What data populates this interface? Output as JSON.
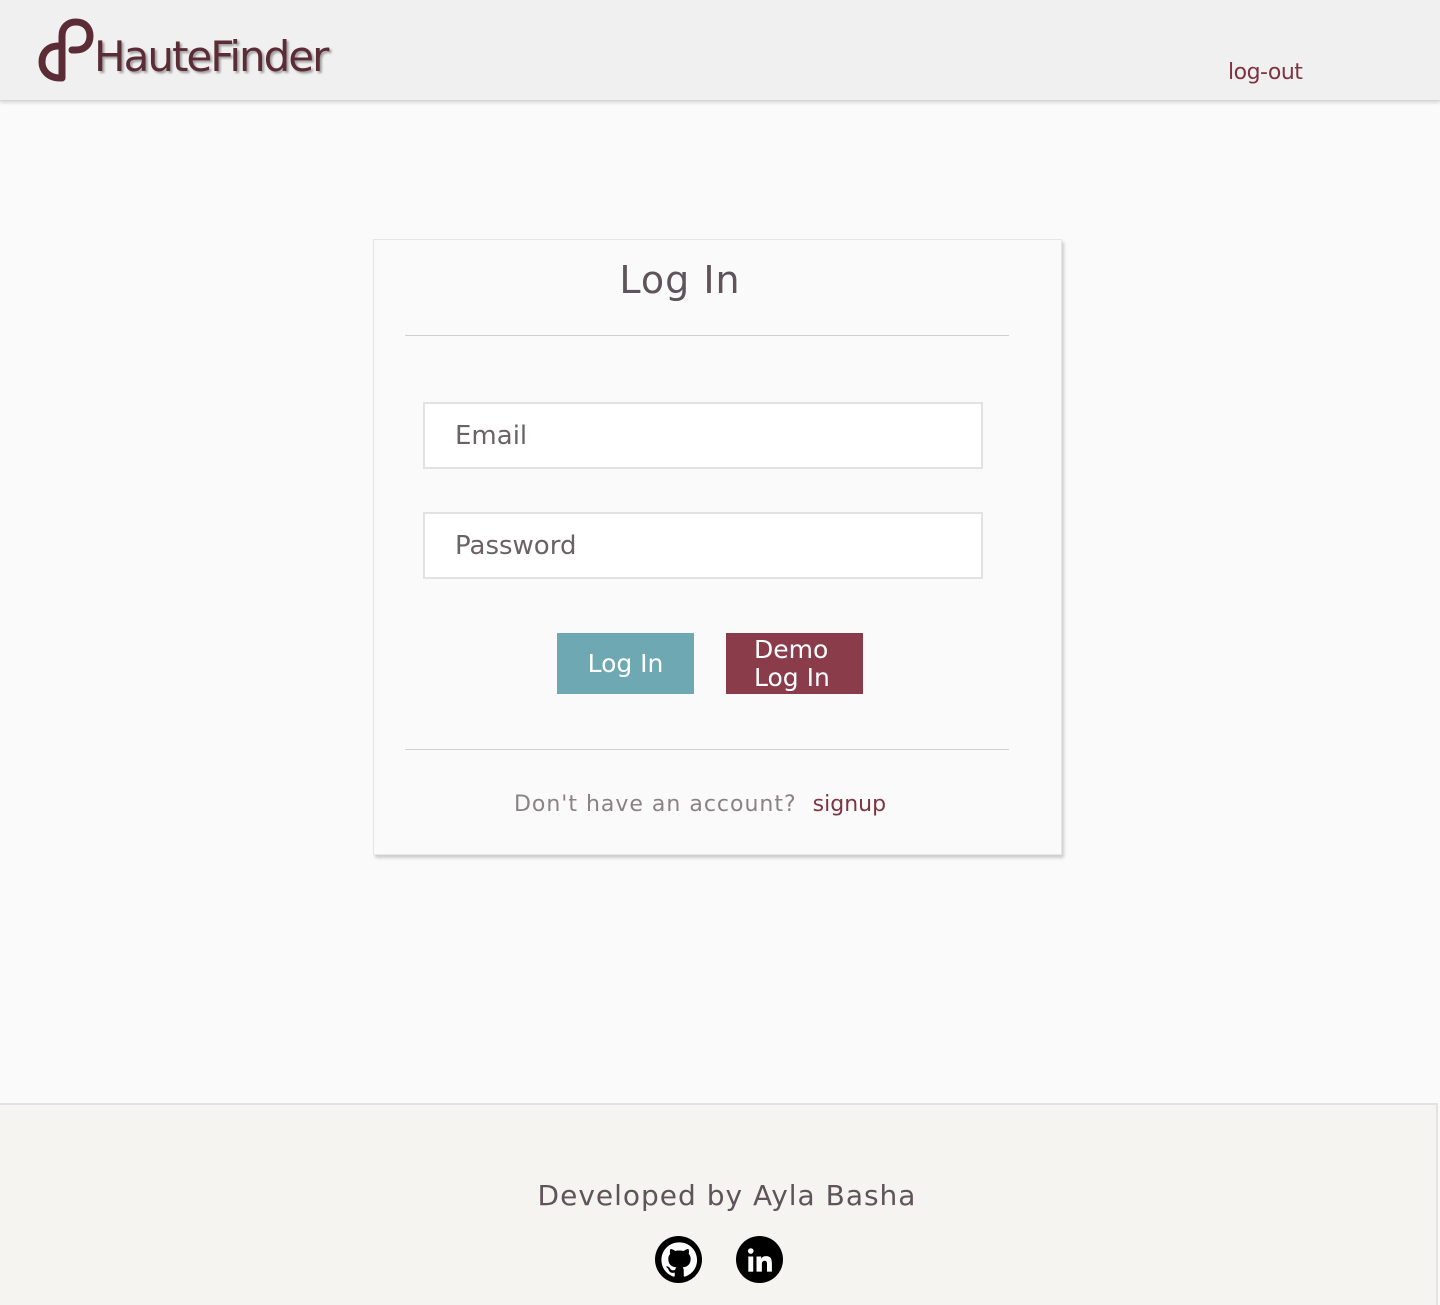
{
  "header": {
    "logo_text": "HauteFinder",
    "logout_label": "log-out"
  },
  "login": {
    "title": "Log In",
    "email_placeholder": "Email",
    "password_placeholder": "Password",
    "login_button": "Log In",
    "demo_button": "Demo Log In",
    "signup_prompt": "Don't have an account?",
    "signup_link": "signup"
  },
  "footer": {
    "credit": "Developed by Ayla Basha",
    "github_icon": "github-icon",
    "linkedin_icon": "linkedin-icon"
  },
  "colors": {
    "brand": "#5b2c36",
    "header_bg": "#f0f0f0",
    "login_button": "#6ea8b3",
    "demo_button": "#8a3c4a",
    "link": "#7d3542",
    "footer_bg": "#f5f4f1"
  }
}
